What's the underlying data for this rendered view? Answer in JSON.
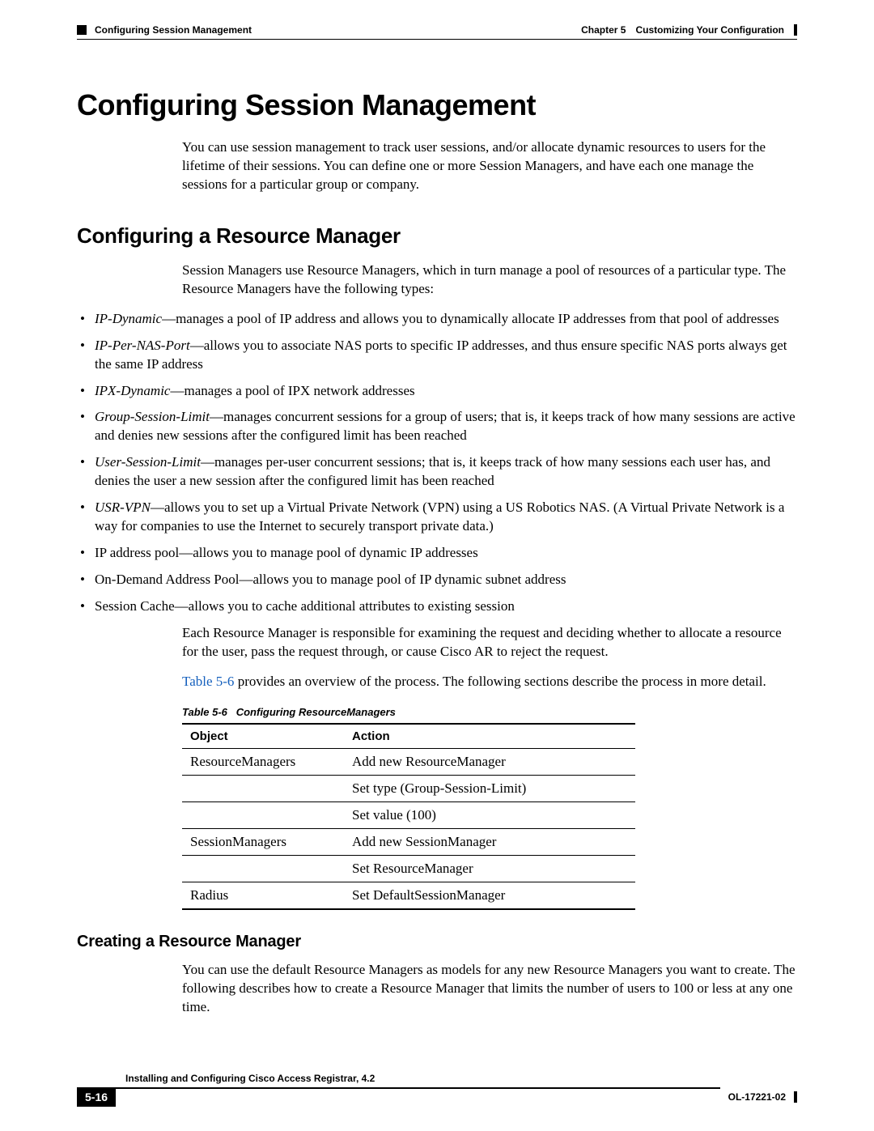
{
  "header": {
    "section": "Configuring Session Management",
    "chapter_label": "Chapter 5",
    "chapter_title": "Customizing Your Configuration"
  },
  "h1": "Configuring Session Management",
  "p1": "You can use session management to track user sessions, and/or allocate dynamic resources to users for the lifetime of their sessions. You can define one or more Session Managers, and have each one manage the sessions for a particular group or company.",
  "h2": "Configuring a Resource Manager",
  "p2": "Session Managers use Resource Managers, which in turn manage a pool of resources of a particular type. The Resource Managers have the following types:",
  "bullets": [
    {
      "em": "IP-Dynamic",
      "rest": "—manages a pool of IP address and allows you to dynamically allocate IP addresses from that pool of addresses"
    },
    {
      "em": "IP-Per-NAS-Port",
      "rest": "—allows you to associate NAS ports to specific IP addresses, and thus ensure specific NAS ports always get the same IP address"
    },
    {
      "em": "IPX-Dynamic",
      "rest": "—manages a pool of IPX network addresses"
    },
    {
      "em": "Group-Session-Limit",
      "rest": "—manages concurrent sessions for a group of users; that is, it keeps track of how many sessions are active and denies new sessions after the configured limit has been reached"
    },
    {
      "em": "User-Session-Limit",
      "rest": "—manages per-user concurrent sessions; that is, it keeps track of how many sessions each user has, and denies the user a new session after the configured limit has been reached"
    },
    {
      "em": "USR-VPN",
      "rest": "—allows you to set up a Virtual Private Network (VPN) using a US Robotics NAS. (A Virtual Private Network is a way for companies to use the Internet to securely transport private data.)"
    },
    {
      "em": "",
      "rest": "IP address pool—allows you to manage pool of dynamic IP addresses"
    },
    {
      "em": "",
      "rest": "On-Demand Address Pool—allows you to manage pool of IP dynamic subnet address"
    },
    {
      "em": "",
      "rest": "Session Cache—allows you to cache additional attributes to existing session"
    }
  ],
  "p3": "Each Resource Manager is responsible for examining the request and deciding whether to allocate a resource for the user, pass the request through, or cause Cisco AR to reject the request.",
  "p4_link": "Table 5-6",
  "p4_rest": " provides an overview of the process. The following sections describe the process in more detail.",
  "table": {
    "caption_label": "Table 5-6",
    "caption_title": "Configuring ResourceManagers",
    "head": {
      "c1": "Object",
      "c2": "Action"
    },
    "rows": [
      {
        "obj": "ResourceManagers",
        "act": "Add new ResourceManager"
      },
      {
        "obj": "",
        "act": "Set type (Group-Session-Limit)"
      },
      {
        "obj": "",
        "act": "Set value (100)"
      },
      {
        "obj": "SessionManagers",
        "act": "Add new SessionManager"
      },
      {
        "obj": "",
        "act": "Set ResourceManager"
      },
      {
        "obj": "Radius",
        "act": "Set DefaultSessionManager"
      }
    ]
  },
  "h3": "Creating a Resource Manager",
  "p5": "You can use the default Resource Managers as models for any new Resource Managers you want to create. The following describes how to create a Resource Manager that limits the number of users to 100 or less at any one time.",
  "footer": {
    "book": "Installing and Configuring Cisco Access Registrar, 4.2",
    "page": "5-16",
    "doc": "OL-17221-02"
  }
}
